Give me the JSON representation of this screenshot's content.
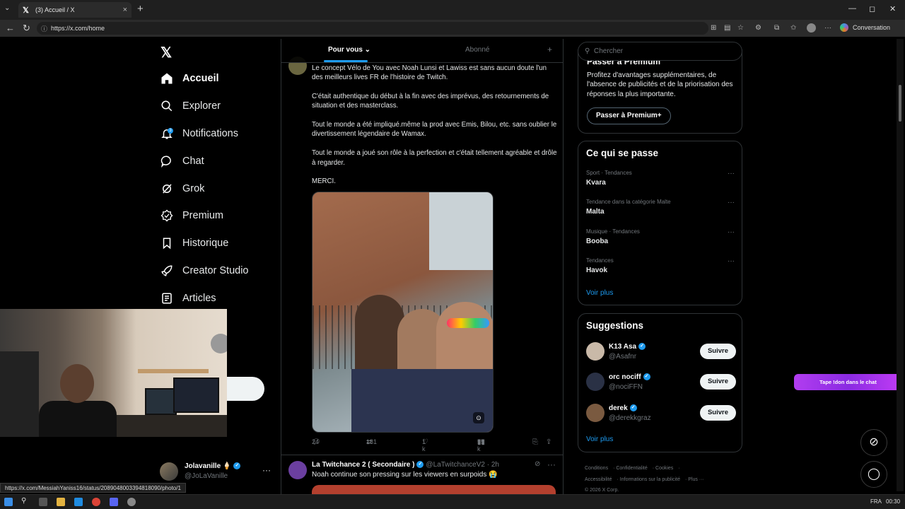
{
  "browser": {
    "tab_title": "(3) Accueil / X",
    "url": "https://x.com/home",
    "conversation_label": "Conversation",
    "status_url": "https://x.com/MessiahYaniss16/status/2089048003394818090/photo/1"
  },
  "nav": {
    "items": [
      {
        "label": "Accueil",
        "icon": "home-icon"
      },
      {
        "label": "Explorer",
        "icon": "search-icon"
      },
      {
        "label": "Notifications",
        "icon": "bell-icon"
      },
      {
        "label": "Chat",
        "icon": "chat-icon"
      },
      {
        "label": "Grok",
        "icon": "grok-icon"
      },
      {
        "label": "Premium",
        "icon": "premium-icon"
      },
      {
        "label": "Historique",
        "icon": "bookmark-icon"
      },
      {
        "label": "Creator Studio",
        "icon": "rocket-icon"
      },
      {
        "label": "Articles",
        "icon": "article-icon"
      }
    ],
    "notification_badge": "3"
  },
  "profile": {
    "name": "Jolavanille 🍦",
    "handle": "@JoLaVanille"
  },
  "timeline": {
    "tabs": [
      "Pour vous",
      "Abonné"
    ],
    "tweet": {
      "paragraphs": [
        "Le concept Vélo de You avec Noah Lunsi et Lawiss est sans aucun doute l'un des meilleurs lives FR de l'histoire de Twitch.",
        "C'était authentique du début à la fin avec des imprévus, des retournements de situation et des masterclass.",
        "Tout le monde a été impliqué.même la prod avec Emis, Bilou, etc. sans oublier le divertissement légendaire de Wamax.",
        "Tout le monde a joué son rôle à la perfection et c'était tellement agréable et drôle à regarder.",
        "MERCI."
      ],
      "replies": "24",
      "reposts": "181",
      "likes": "1 k",
      "views": "55 k"
    },
    "tweet2": {
      "name": "La Twitchance 2 ( Secondaire )",
      "handle": "@LaTwitchanceV2 · 2h",
      "text": "Noah continue son pressing sur les viewers en surpoids 😭"
    }
  },
  "sidebar": {
    "search_placeholder": "Chercher",
    "premium": {
      "title": "Passer à Premium",
      "desc": "Profitez d'avantages supplémentaires, de l'absence de publicités et de la priorisation des réponses la plus importante.",
      "button": "Passer à Premium+"
    },
    "trends_title": "Ce qui se passe",
    "trends": [
      {
        "category": "Sport · Tendances",
        "name": "Kvara"
      },
      {
        "category": "Tendance dans la catégorie Malte",
        "name": "Malta"
      },
      {
        "category": "Musique · Tendances",
        "name": "Booba"
      },
      {
        "category": "Tendances",
        "name": "Havok"
      }
    ],
    "see_more": "Voir plus",
    "suggestions_title": "Suggestions",
    "suggestions": [
      {
        "name": "K13 Asa",
        "handle": "@Asafnr",
        "button": "Suivre"
      },
      {
        "name": "orc nociff",
        "handle": "@nociFFN",
        "button": "Suivre"
      },
      {
        "name": "derek",
        "handle": "@derekkgraz",
        "button": "Suivre"
      }
    ],
    "footer": [
      "Conditions",
      "Confidentialité",
      "Cookies",
      "Accessibilité",
      "Informations sur la publicité",
      "Plus ···",
      "© 2026 X Corp."
    ]
  },
  "overlay": {
    "chat_banner": "Tape !don dans le chat"
  },
  "taskbar": {
    "lang": "FRA",
    "time": "00:30"
  }
}
